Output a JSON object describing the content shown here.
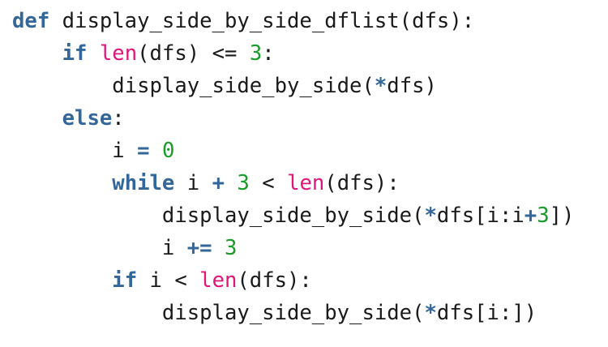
{
  "colors": {
    "background": "#ffffff",
    "default_text": "#1a1a1a",
    "keyword": "#336699",
    "builtin": "#e0157a",
    "number": "#1a9c2a",
    "operator": "#336699"
  },
  "code": {
    "language": "python",
    "lines": [
      {
        "indent": 0,
        "tokens": [
          {
            "t": "def",
            "c": "kw"
          },
          {
            "t": " display_side_by_side_dflist(dfs):",
            "c": "plain"
          }
        ]
      },
      {
        "indent": 1,
        "tokens": [
          {
            "t": "if",
            "c": "kw"
          },
          {
            "t": " ",
            "c": "plain"
          },
          {
            "t": "len",
            "c": "builtin"
          },
          {
            "t": "(dfs) ",
            "c": "plain"
          },
          {
            "t": "<=",
            "c": "plain"
          },
          {
            "t": " ",
            "c": "plain"
          },
          {
            "t": "3",
            "c": "num"
          },
          {
            "t": ":",
            "c": "plain"
          }
        ]
      },
      {
        "indent": 2,
        "tokens": [
          {
            "t": "display_side_by_side(",
            "c": "plain"
          },
          {
            "t": "*",
            "c": "op"
          },
          {
            "t": "dfs)",
            "c": "plain"
          }
        ]
      },
      {
        "indent": 1,
        "tokens": [
          {
            "t": "else",
            "c": "kw"
          },
          {
            "t": ":",
            "c": "plain"
          }
        ]
      },
      {
        "indent": 2,
        "tokens": [
          {
            "t": "i ",
            "c": "plain"
          },
          {
            "t": "=",
            "c": "op"
          },
          {
            "t": " ",
            "c": "plain"
          },
          {
            "t": "0",
            "c": "num"
          }
        ]
      },
      {
        "indent": 2,
        "tokens": [
          {
            "t": "while",
            "c": "kw"
          },
          {
            "t": " i ",
            "c": "plain"
          },
          {
            "t": "+",
            "c": "op"
          },
          {
            "t": " ",
            "c": "plain"
          },
          {
            "t": "3",
            "c": "num"
          },
          {
            "t": " < ",
            "c": "plain"
          },
          {
            "t": "len",
            "c": "builtin"
          },
          {
            "t": "(dfs):",
            "c": "plain"
          }
        ]
      },
      {
        "indent": 3,
        "tokens": [
          {
            "t": "display_side_by_side(",
            "c": "plain"
          },
          {
            "t": "*",
            "c": "op"
          },
          {
            "t": "dfs[i:i",
            "c": "plain"
          },
          {
            "t": "+",
            "c": "op"
          },
          {
            "t": "3",
            "c": "num"
          },
          {
            "t": "])",
            "c": "plain"
          }
        ]
      },
      {
        "indent": 3,
        "tokens": [
          {
            "t": "i ",
            "c": "plain"
          },
          {
            "t": "+=",
            "c": "op"
          },
          {
            "t": " ",
            "c": "plain"
          },
          {
            "t": "3",
            "c": "num"
          }
        ]
      },
      {
        "indent": 2,
        "tokens": [
          {
            "t": "if",
            "c": "kw"
          },
          {
            "t": " i < ",
            "c": "plain"
          },
          {
            "t": "len",
            "c": "builtin"
          },
          {
            "t": "(dfs):",
            "c": "plain"
          }
        ]
      },
      {
        "indent": 3,
        "tokens": [
          {
            "t": "display_side_by_side(",
            "c": "plain"
          },
          {
            "t": "*",
            "c": "op"
          },
          {
            "t": "dfs[i:])",
            "c": "plain"
          }
        ]
      }
    ]
  }
}
